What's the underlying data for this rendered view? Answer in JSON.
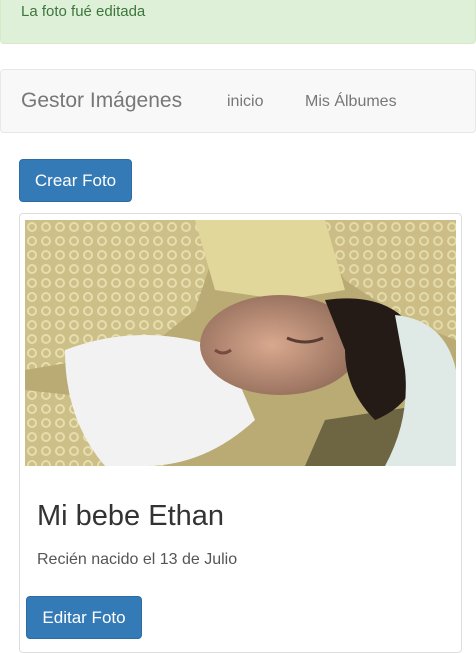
{
  "alert": {
    "message": "La foto fué editada"
  },
  "navbar": {
    "brand": "Gestor Imágenes",
    "links": [
      {
        "label": "inicio"
      },
      {
        "label": "Mis Álbumes"
      }
    ]
  },
  "actions": {
    "create_label": "Crear Foto"
  },
  "photo_card": {
    "image_subject": "sleeping-newborn-photo",
    "title": "Mi bebe Ethan",
    "description": "Recién nacido el 13 de Julio",
    "edit_label": "Editar Foto"
  },
  "colors": {
    "primary": "#337ab7",
    "success_bg": "#dff0d8",
    "success_text": "#3c763d",
    "navbar_bg": "#f8f8f8"
  }
}
